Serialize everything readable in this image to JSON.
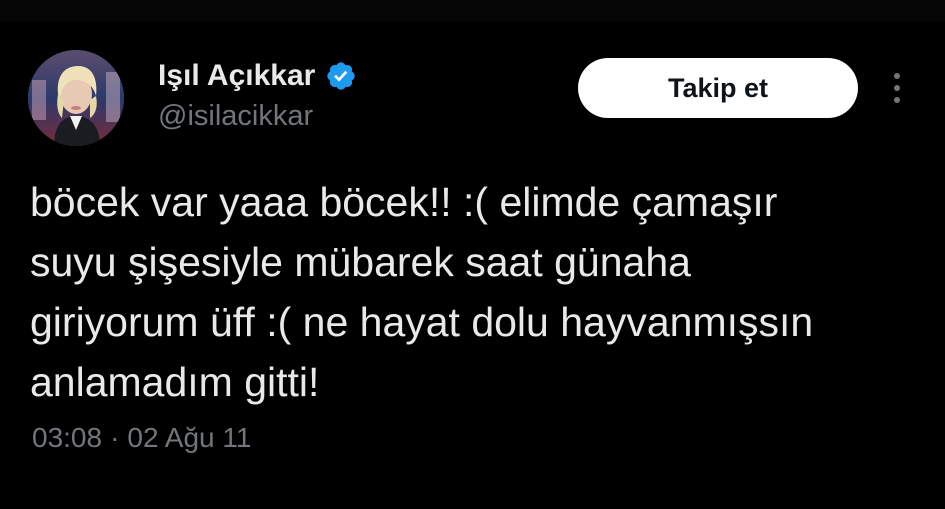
{
  "author": {
    "display_name": "Işıl Açıkkar",
    "handle": "@isilacikkar",
    "verified_icon": "verified-badge-icon",
    "avatar": "profile-photo"
  },
  "actions": {
    "follow_label": "Takip et",
    "more_icon": "more-vertical-icon"
  },
  "tweet": {
    "lines": [
      "böcek var yaaa böcek!! :( elimde çamaşır",
      "suyu şişesiyle mübarek saat günaha",
      "giriyorum üff :( ne hayat dolu hayvanmışsın",
      "anlamadım gitti!"
    ]
  },
  "meta": {
    "time": "03:08",
    "separator": "·",
    "date": "02 Ağu 11"
  },
  "colors": {
    "background": "#000000",
    "primary_text": "#e7e9ea",
    "secondary_text": "#71767b",
    "verified": "#1d9bf0",
    "button_bg": "#ffffff"
  }
}
